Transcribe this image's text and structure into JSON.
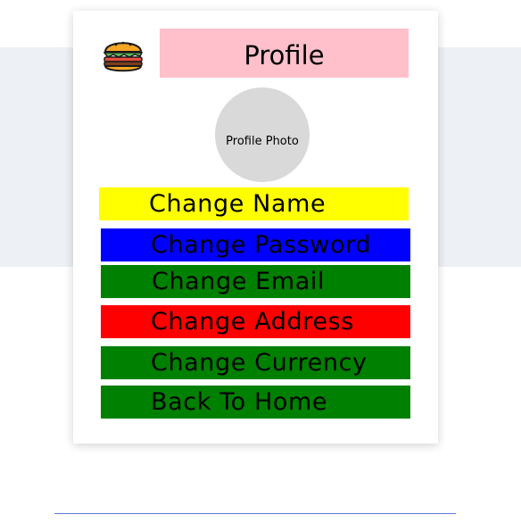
{
  "profile": {
    "logo_icon": "burger-icon",
    "title": "Profile",
    "photo_label": "Profile Photo"
  },
  "options": {
    "change_name": {
      "label": "Change Name",
      "color": "#ffff00"
    },
    "change_password": {
      "label": "Change Password",
      "color": "#0000ff"
    },
    "change_email": {
      "label": "Change Email",
      "color": "#008000"
    },
    "change_address": {
      "label": "Change Address",
      "color": "#ff0000"
    },
    "change_currency": {
      "label": "Change Currency",
      "color": "#008000"
    },
    "back_to_home": {
      "label": "Back To Home",
      "color": "#008000"
    }
  },
  "colors": {
    "title_background": "#ffc0cb",
    "photo_background": "#d9d9d9",
    "page_band": "#edf1f6",
    "divider": "#5a78d6"
  }
}
